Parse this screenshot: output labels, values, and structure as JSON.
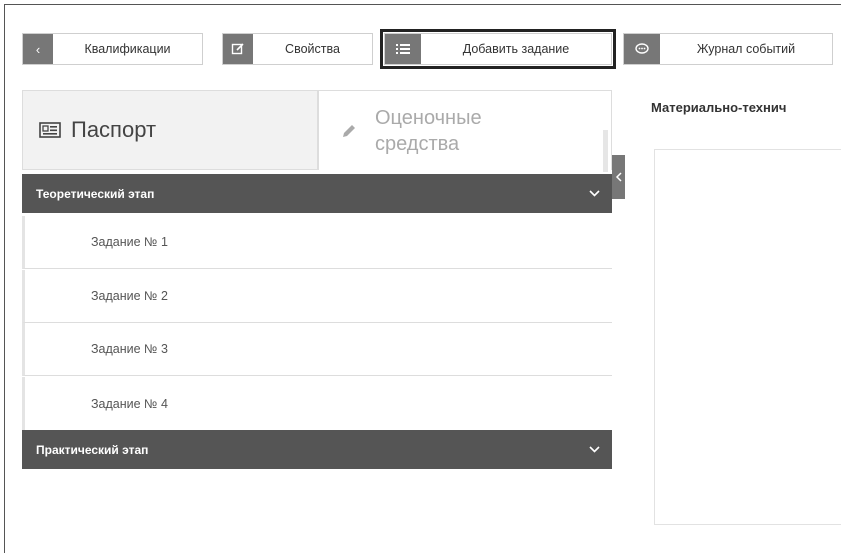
{
  "toolbar": {
    "back": {
      "icon": "chevron-left-icon",
      "label": "Квалификации"
    },
    "properties": {
      "icon": "edit-icon",
      "label": "Свойства"
    },
    "add_task": {
      "icon": "list-icon",
      "label": "Добавить задание"
    },
    "event_log": {
      "icon": "chat-icon",
      "label": "Журнал событий"
    }
  },
  "tabs": {
    "passport": {
      "icon": "id-card-icon",
      "label": "Паспорт"
    },
    "assessment": {
      "icon": "pencil-icon",
      "line1": "Оценочные",
      "line2": "средства"
    }
  },
  "sections": {
    "theory": {
      "title": "Теоретический этап",
      "tasks": [
        "Задание № 1",
        "Задание № 2",
        "Задание № 3",
        "Задание № 4"
      ]
    },
    "practice": {
      "title": "Практический этап"
    }
  },
  "right": {
    "title": "Материально-технич"
  },
  "colors": {
    "dark_header": "#555555",
    "icon_bg": "#777777",
    "selected_outline": "#222222"
  }
}
